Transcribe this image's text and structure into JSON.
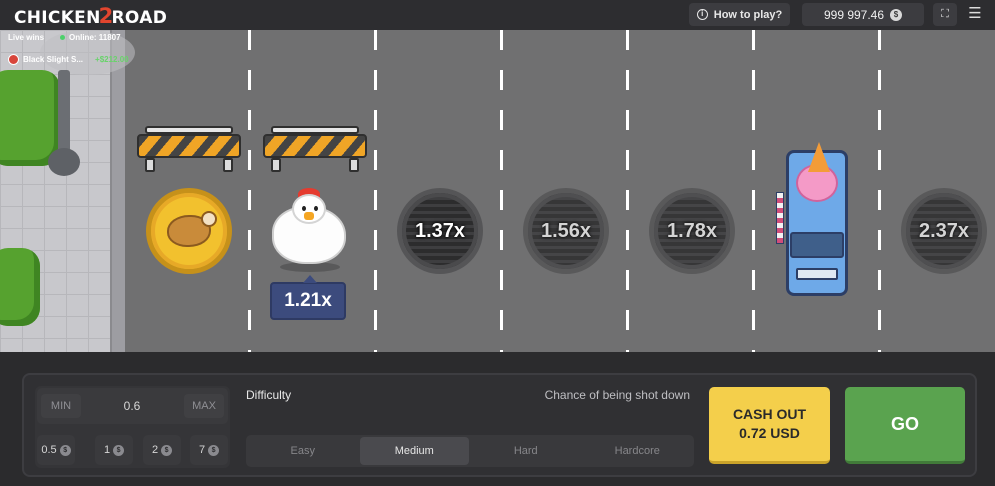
{
  "header": {
    "logo_left": "CHICKEN",
    "logo_two": "2",
    "logo_right": "ROAD",
    "how_to_play": "How to play?",
    "balance": "999 997.46",
    "currency_symbol": "$",
    "menu_glyph": "☰",
    "fullscreen_glyph": "⛶"
  },
  "live": {
    "label": "Live wins",
    "online": "Online: 11807",
    "winner_name": "Black Slight S...",
    "winner_amount": "+$212.00"
  },
  "road": {
    "current_multiplier": "1.21x",
    "multipliers": [
      "1.37x",
      "1.56x",
      "1.78x",
      "2.37x"
    ],
    "first_tile": "roast-chicken-icon",
    "obstacle": "ice-cream-truck"
  },
  "controls": {
    "bet": {
      "min_label": "MIN",
      "max_label": "MAX",
      "value": "0.6",
      "presets": [
        "0.5",
        "1",
        "2",
        "7"
      ]
    },
    "difficulty_label": "Difficulty",
    "chance_label": "Chance of being shot down",
    "difficulties": [
      "Easy",
      "Medium",
      "Hard",
      "Hardcore"
    ],
    "selected_difficulty": "Medium",
    "cashout_line1": "CASH OUT",
    "cashout_line2": "0.72 USD",
    "go_label": "GO"
  },
  "colors": {
    "cashout": "#f4cf4b",
    "go": "#5aa34f",
    "multiplier_badge": "#3c4b7d",
    "road": "#707071"
  }
}
